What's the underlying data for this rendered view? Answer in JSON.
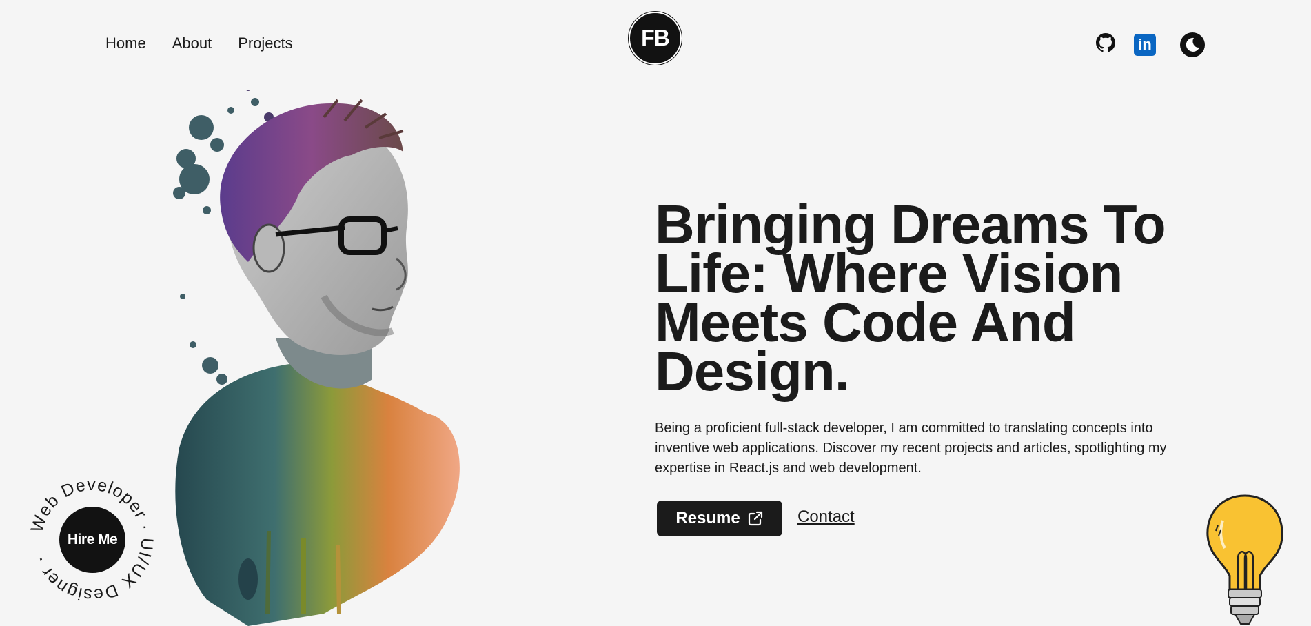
{
  "nav": {
    "items": [
      {
        "label": "Home",
        "active": true
      },
      {
        "label": "About",
        "active": false
      },
      {
        "label": "Projects",
        "active": false
      }
    ]
  },
  "logo": {
    "text": "FB"
  },
  "social": {
    "github_icon": "github-icon",
    "linkedin_icon": "linkedin-icon",
    "linkedin_text": "in",
    "theme_icon": "moon-icon",
    "linkedin_color": "#0a66c2"
  },
  "hero": {
    "headline": "Bringing Dreams To Life: Where Vision Meets Code And Design.",
    "description": "Being a proficient full-stack developer, I am committed to translating concepts into inventive web applications. Discover my recent projects and articles, spotlighting my expertise in React.js and web development.",
    "resume_label": "Resume",
    "contact_label": "Contact"
  },
  "hire": {
    "button_label": "Hire Me",
    "ring_text": "Web Developer · UI/UX Designer · "
  },
  "colors": {
    "background": "#f5f5f5",
    "dark": "#1b1b1b",
    "bulb": "#f9c232"
  }
}
